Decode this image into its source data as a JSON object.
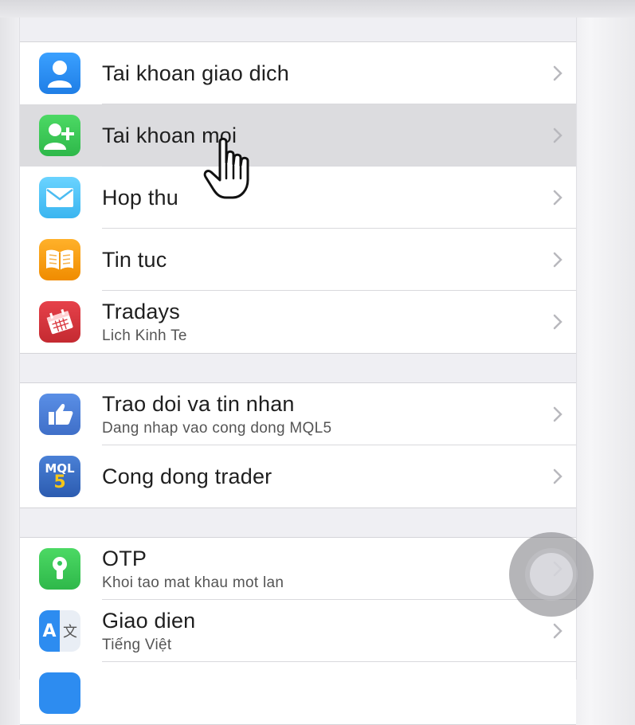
{
  "groups": [
    {
      "items": [
        {
          "title": "Tai khoan giao dich",
          "subtitle": "",
          "icon": "user-icon",
          "color": "#2d8cf0"
        },
        {
          "title": "Tai khoan moi",
          "subtitle": "",
          "icon": "add-user-icon",
          "color": "#34c759",
          "highlighted": true
        },
        {
          "title": "Hop thu",
          "subtitle": "",
          "icon": "mail-icon",
          "color": "#5ac8fa"
        },
        {
          "title": "Tin tuc",
          "subtitle": "",
          "icon": "book-icon",
          "color": "#ff9f0a"
        },
        {
          "title": "Tradays",
          "subtitle": "Lich Kinh Te",
          "icon": "calendar-icon",
          "color": "#d9323a"
        }
      ]
    },
    {
      "items": [
        {
          "title": "Trao doi va tin nhan",
          "subtitle": "Dang nhap vao cong dong MQL5",
          "icon": "thumb-icon",
          "color": "#4a7fd8"
        },
        {
          "title": "Cong dong trader",
          "subtitle": "",
          "icon": "mql5-icon",
          "color": "#3a6fc4"
        }
      ]
    },
    {
      "items": [
        {
          "title": "OTP",
          "subtitle": "Khoi tao mat khau mot lan",
          "icon": "lock-icon",
          "color": "#34c759"
        },
        {
          "title": "Giao dien",
          "subtitle": "Tiếng Việt",
          "icon": "language-icon",
          "color": "#2d8cf0"
        }
      ]
    }
  ],
  "mql5_icon_text": {
    "top": "MQL",
    "bottom": "5"
  },
  "language_icon_text": {
    "latin": "A",
    "cjk": "文"
  }
}
